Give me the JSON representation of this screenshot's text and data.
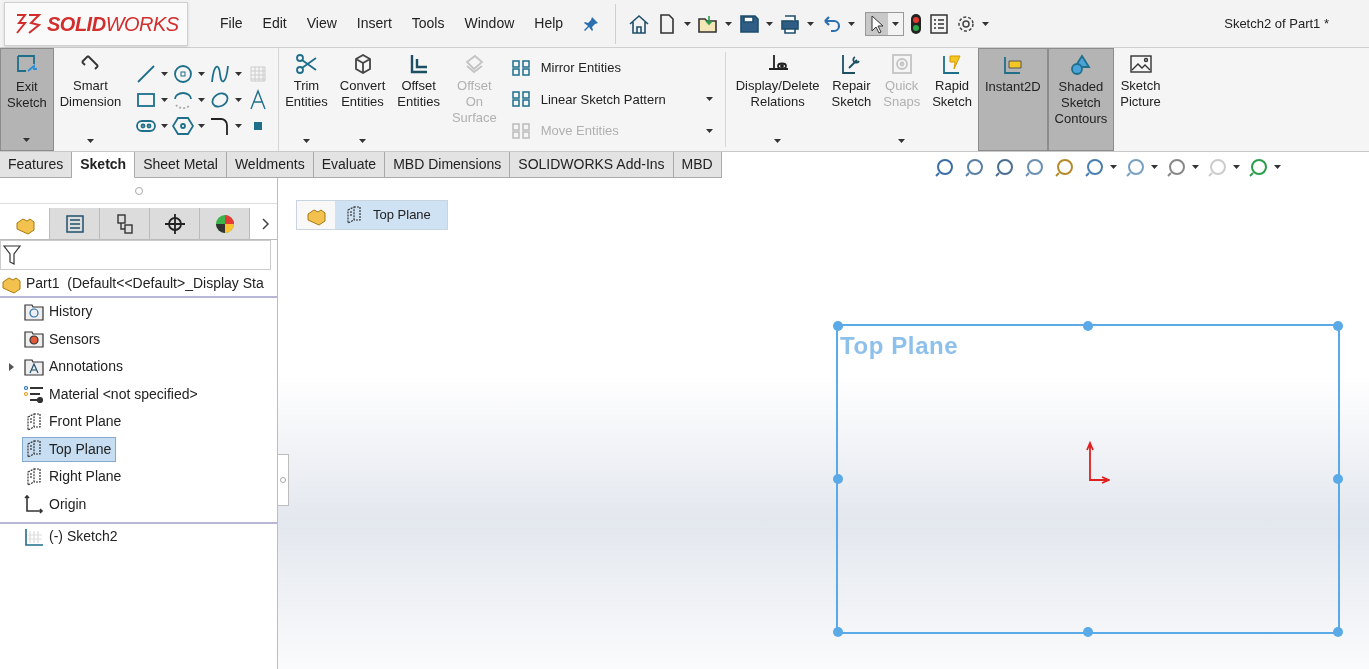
{
  "app": {
    "logo": "**SOLID**WORKS",
    "menu": [
      "File",
      "Edit",
      "View",
      "Insert",
      "Tools",
      "Window",
      "Help"
    ],
    "document_title": "Sketch2 of Part1 *"
  },
  "ribbon": {
    "tools": [
      {
        "kind": "large",
        "label": "Exit Sketch",
        "pressed": true,
        "disabled": false,
        "dropdown": true
      },
      {
        "kind": "large",
        "label": "Smart Dimension",
        "pressed": false,
        "disabled": false,
        "dropdown": true
      },
      {
        "kind": "grid"
      },
      {
        "kind": "large",
        "label": "Trim Entities",
        "pressed": false,
        "disabled": false,
        "dropdown": true
      },
      {
        "kind": "large",
        "label": "Convert Entities",
        "pressed": false,
        "disabled": false,
        "dropdown": true
      },
      {
        "kind": "large",
        "label": "Offset Entities",
        "pressed": false,
        "disabled": false,
        "dropdown": false
      },
      {
        "kind": "large",
        "label": "Offset On Surface",
        "pressed": false,
        "disabled": true,
        "dropdown": false
      },
      {
        "kind": "list",
        "items": [
          {
            "label": "Mirror Entities",
            "disabled": false,
            "dropdown": false
          },
          {
            "label": "Linear Sketch Pattern",
            "disabled": false,
            "dropdown": true
          },
          {
            "label": "Move Entities",
            "disabled": true,
            "dropdown": true
          }
        ]
      },
      {
        "kind": "separator"
      },
      {
        "kind": "large",
        "label": "Display/Delete Relations",
        "pressed": false,
        "disabled": false,
        "dropdown": true
      },
      {
        "kind": "large",
        "label": "Repair Sketch",
        "pressed": false,
        "disabled": false,
        "dropdown": false
      },
      {
        "kind": "large",
        "label": "Quick Snaps",
        "pressed": false,
        "disabled": true,
        "dropdown": true
      },
      {
        "kind": "large",
        "label": "Rapid Sketch",
        "pressed": false,
        "disabled": false,
        "dropdown": false
      },
      {
        "kind": "large",
        "label": "Instant2D",
        "pressed": true,
        "disabled": false,
        "dropdown": false
      },
      {
        "kind": "large",
        "label": "Shaded Sketch Contours",
        "pressed": true,
        "disabled": false,
        "dropdown": false
      },
      {
        "kind": "large",
        "label": "Sketch Picture",
        "pressed": false,
        "disabled": false,
        "dropdown": false
      }
    ]
  },
  "tabs": [
    {
      "label": "Features",
      "selected": false
    },
    {
      "label": "Sketch",
      "selected": true
    },
    {
      "label": "Sheet Metal",
      "selected": false
    },
    {
      "label": "Weldments",
      "selected": false
    },
    {
      "label": "Evaluate",
      "selected": false
    },
    {
      "label": "MBD Dimensions",
      "selected": false
    },
    {
      "label": "SOLIDWORKS Add-Ins",
      "selected": false
    },
    {
      "label": "MBD",
      "selected": false
    }
  ],
  "panel_tabs": [
    {
      "selected": true
    },
    {
      "selected": false
    },
    {
      "selected": false
    },
    {
      "selected": false
    },
    {
      "selected": false
    }
  ],
  "tree": {
    "root": "Part1  (Default<<Default>_Display Sta",
    "children": [
      {
        "label": "History",
        "kind": "history",
        "selected": false
      },
      {
        "label": "Sensors",
        "kind": "sensors",
        "selected": false
      },
      {
        "label": "Annotations",
        "kind": "annotations",
        "selected": false,
        "expanded": false
      },
      {
        "label": "Material <not specified>",
        "kind": "material",
        "selected": false
      },
      {
        "label": "Front Plane",
        "kind": "plane",
        "selected": false
      },
      {
        "label": "Top Plane",
        "kind": "plane",
        "selected": true
      },
      {
        "label": "Right Plane",
        "kind": "plane",
        "selected": false
      },
      {
        "label": "Origin",
        "kind": "origin",
        "selected": false
      },
      {
        "label": "(-) Sketch2",
        "kind": "sketch",
        "selected": false
      }
    ]
  },
  "breadcrumb": {
    "label": "Top Plane"
  },
  "canvas": {
    "plane_label": "Top Plane"
  }
}
